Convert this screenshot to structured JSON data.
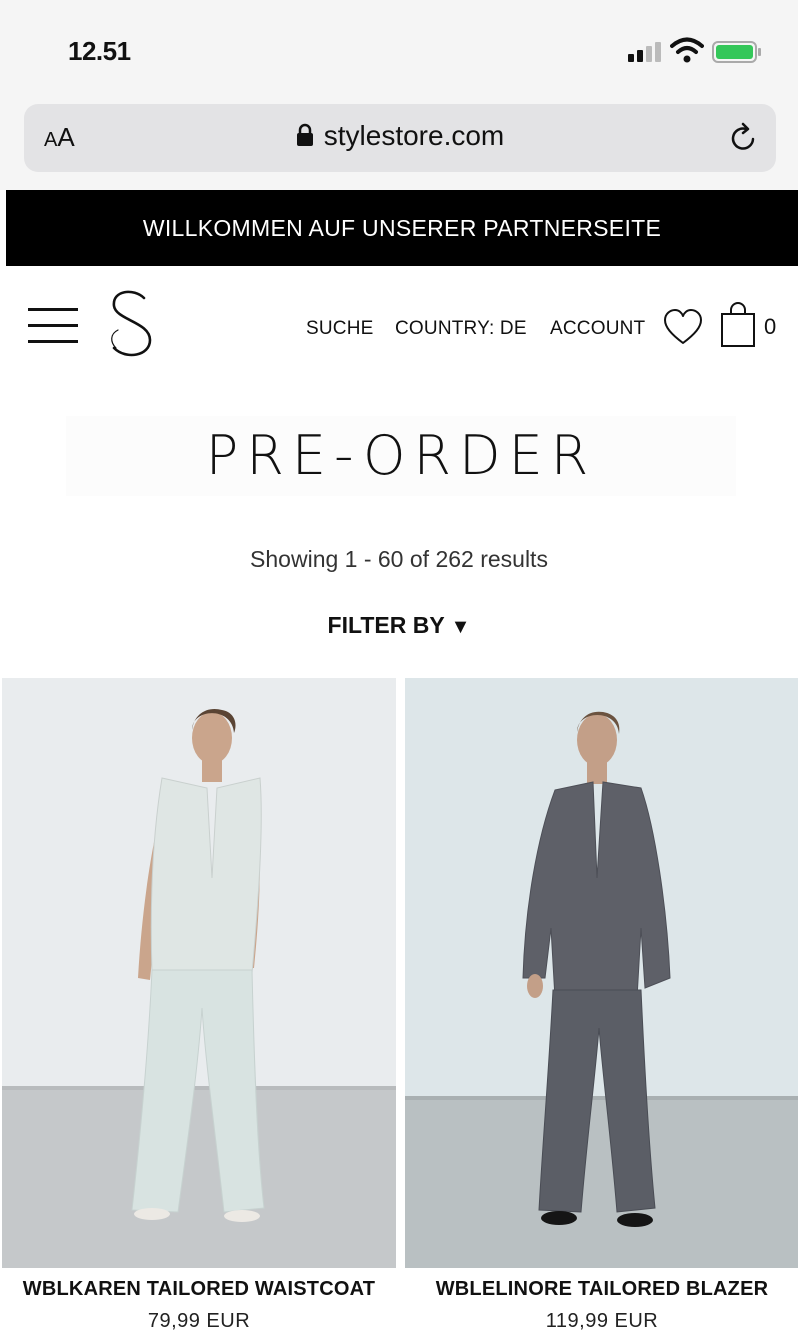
{
  "status_bar": {
    "time": "12.51",
    "icons": [
      "signal-icon",
      "wifi-icon",
      "battery-icon"
    ],
    "battery_color": "#34c759"
  },
  "browser": {
    "text_size_label_small": "A",
    "text_size_label_large": "A",
    "url": "stylestore.com",
    "icons": [
      "lock-icon",
      "reload-icon"
    ]
  },
  "announcement": {
    "text": "WILLKOMMEN AUF UNSERER PARTNERSEITE",
    "background": "#000000"
  },
  "header": {
    "icons": [
      "menu-icon",
      "logo",
      "heart-icon",
      "bag-icon"
    ],
    "nav": {
      "search": "SUCHE",
      "country": "COUNTRY: DE",
      "account": "ACCOUNT"
    },
    "cart_count": "0"
  },
  "main": {
    "title": "PRE-ORDER",
    "results": "Showing 1 - 60 of 262 results",
    "filter_label": "FILTER BY",
    "filter_arrow": "▼"
  },
  "products": [
    {
      "name": "WBLKAREN TAILORED WAISTCOAT",
      "price": "79,99 EUR",
      "garment_color": "#dfe6e4"
    },
    {
      "name": "WBLELINORE TAILORED BLAZER",
      "price": "119,99 EUR",
      "garment_color": "#5e6068"
    }
  ]
}
